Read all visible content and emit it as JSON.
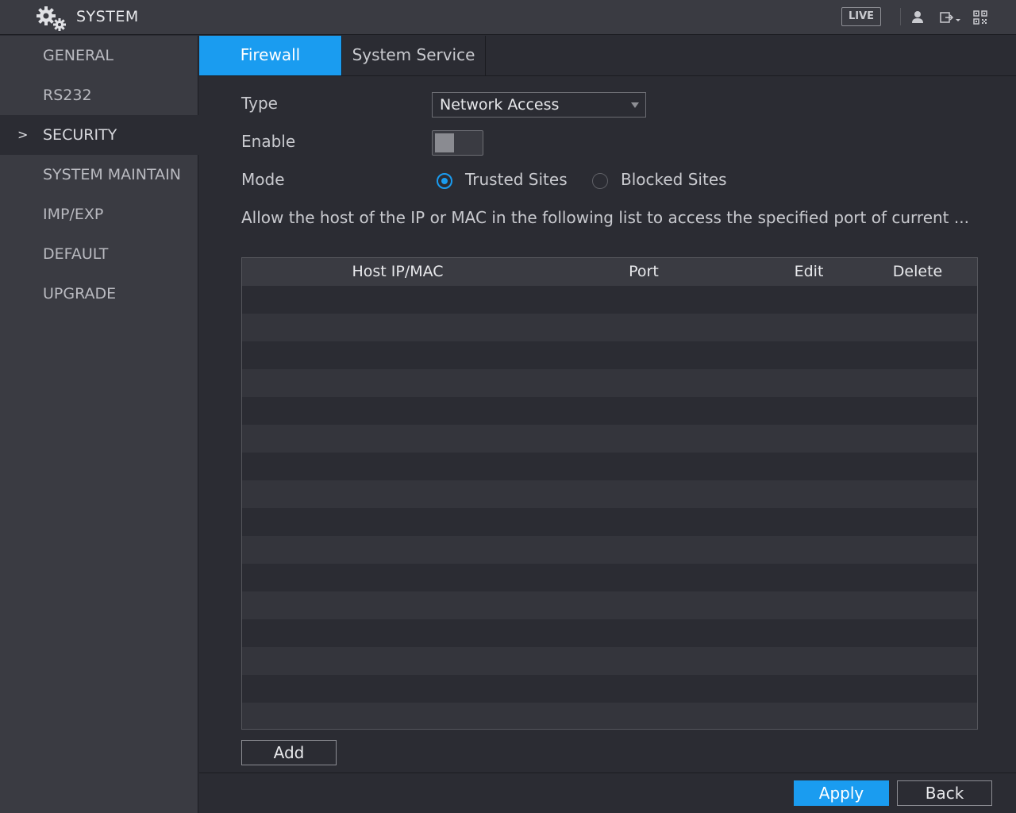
{
  "header": {
    "title": "SYSTEM",
    "live_label": "LIVE",
    "icons": [
      "system-gear-icon",
      "user-icon",
      "logout-icon",
      "qrcode-icon"
    ]
  },
  "sidebar": {
    "items": [
      {
        "label": "GENERAL"
      },
      {
        "label": "RS232"
      },
      {
        "label": "SECURITY",
        "active": true
      },
      {
        "label": "SYSTEM MAINTAIN"
      },
      {
        "label": "IMP/EXP"
      },
      {
        "label": "DEFAULT"
      },
      {
        "label": "UPGRADE"
      }
    ],
    "active_indicator": ">"
  },
  "tabs": [
    {
      "label": "Firewall",
      "active": true
    },
    {
      "label": "System Service"
    }
  ],
  "form": {
    "type_label": "Type",
    "type_value": "Network Access",
    "enable_label": "Enable",
    "enable_on": false,
    "mode_label": "Mode",
    "mode_options": [
      {
        "label": "Trusted Sites",
        "selected": true
      },
      {
        "label": "Blocked Sites",
        "selected": false
      }
    ],
    "description": "Allow the host of the IP or MAC in the following list to access the specified port of current ..."
  },
  "table": {
    "columns": [
      "Host IP/MAC",
      "Port",
      "Edit",
      "Delete"
    ],
    "rows": []
  },
  "buttons": {
    "add": "Add",
    "apply": "Apply",
    "back": "Back"
  },
  "colors": {
    "accent": "#1a9cf0",
    "background": "#2b2c33",
    "panel": "#3a3b42"
  }
}
